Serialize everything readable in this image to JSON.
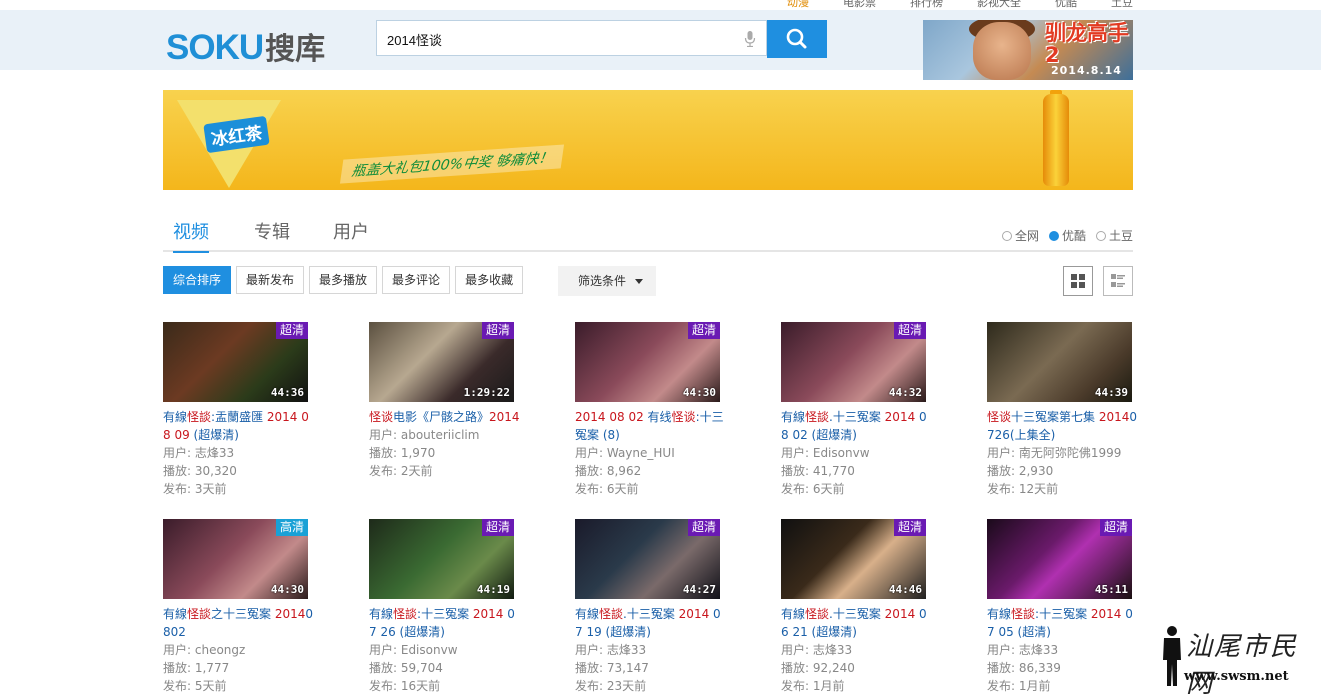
{
  "topnav": {
    "items": [
      "动漫",
      "电影票",
      "排行榜",
      "影视大全",
      "优酷",
      "土豆"
    ]
  },
  "logo": {
    "latin": "SOKU",
    "cn": "搜库"
  },
  "search": {
    "query": "2014怪谈"
  },
  "promo": {
    "title": "驯龙高手2",
    "date": "2014.8.14"
  },
  "ad": {
    "brand": "冰红茶",
    "slogan": "瓶盖大礼包100%中奖 够痛快！"
  },
  "tabs": [
    "视频",
    "专辑",
    "用户"
  ],
  "source_filter": [
    {
      "label": "全网",
      "selected": false
    },
    {
      "label": "优酷",
      "selected": true
    },
    {
      "label": "土豆",
      "selected": false
    }
  ],
  "sort": [
    "综合排序",
    "最新发布",
    "最多播放",
    "最多评论",
    "最多收藏"
  ],
  "filter_label": "筛选条件",
  "labels": {
    "user": "用户: ",
    "plays": "播放: ",
    "published": "发布: "
  },
  "colors": {
    "accent": "#1f8fe0",
    "highlight": "#c8161d",
    "badge_super": "#6a1ab3",
    "badge_hd": "#19a1d6"
  },
  "videos": [
    {
      "title": [
        [
          "有線",
          ""
        ],
        [
          "怪談",
          "hl"
        ],
        [
          ":盂蘭盛匯 ",
          ""
        ],
        [
          "2014 08 09",
          "hl"
        ],
        [
          " (超爆清)",
          ""
        ]
      ],
      "badge": "超清",
      "duration": "44:36",
      "user": "志烽33",
      "plays": "30,320",
      "published": "3天前"
    },
    {
      "title": [
        [
          "怪谈",
          "hl"
        ],
        [
          "电影《尸骸之路》",
          ""
        ],
        [
          "2014",
          "hl"
        ]
      ],
      "badge": "超清",
      "duration": "1:29:22",
      "user": "abouteriiclim",
      "plays": "1,970",
      "published": "2天前"
    },
    {
      "title": [
        [
          "2014 08 02",
          "hl"
        ],
        [
          " 有线",
          ""
        ],
        [
          "怪谈",
          "hl"
        ],
        [
          ":十三冤案 (8)",
          ""
        ]
      ],
      "badge": "超清",
      "duration": "44:30",
      "user": "Wayne_HUI",
      "plays": "8,962",
      "published": "6天前"
    },
    {
      "title": [
        [
          "有線",
          ""
        ],
        [
          "怪談",
          "hl"
        ],
        [
          ".十三冤案 ",
          ""
        ],
        [
          "2014",
          "hl"
        ],
        [
          " 08 02 (超爆清)",
          ""
        ]
      ],
      "badge": "超清",
      "duration": "44:32",
      "user": "Edisonvw",
      "plays": "41,770",
      "published": "6天前"
    },
    {
      "title": [
        [
          "怪谈",
          "hl"
        ],
        [
          "十三冤案第七集 ",
          ""
        ],
        [
          "2014",
          "hl"
        ],
        [
          "0726(上集全)",
          ""
        ]
      ],
      "badge": "",
      "duration": "44:39",
      "user": "南无阿弥陀佛1999",
      "plays": "2,930",
      "published": "12天前"
    },
    {
      "title": [
        [
          "有線",
          ""
        ],
        [
          "怪談",
          "hl"
        ],
        [
          "之十三冤案 ",
          ""
        ],
        [
          "2014",
          "hl"
        ],
        [
          "0802",
          ""
        ]
      ],
      "badge": "高清",
      "duration": "44:30",
      "user": "cheongz",
      "plays": "1,777",
      "published": "5天前"
    },
    {
      "title": [
        [
          "有線",
          ""
        ],
        [
          "怪談",
          "hl"
        ],
        [
          ":十三冤案 ",
          ""
        ],
        [
          "2014",
          "hl"
        ],
        [
          " 07 26 (超爆清)",
          ""
        ]
      ],
      "badge": "超清",
      "duration": "44:19",
      "user": "Edisonvw",
      "plays": "59,704",
      "published": "16天前"
    },
    {
      "title": [
        [
          "有線",
          ""
        ],
        [
          "怪談",
          "hl"
        ],
        [
          ".十三冤案 ",
          ""
        ],
        [
          "2014",
          "hl"
        ],
        [
          " 07 19 (超爆清)",
          ""
        ]
      ],
      "badge": "超清",
      "duration": "44:27",
      "user": "志烽33",
      "plays": "73,147",
      "published": "23天前"
    },
    {
      "title": [
        [
          "有線",
          ""
        ],
        [
          "怪談",
          "hl"
        ],
        [
          ".十三冤案 ",
          ""
        ],
        [
          "2014",
          "hl"
        ],
        [
          " 06 21 (超爆清)",
          ""
        ]
      ],
      "badge": "超清",
      "duration": "44:46",
      "user": "志烽33",
      "plays": "92,240",
      "published": "1月前"
    },
    {
      "title": [
        [
          "有線",
          ""
        ],
        [
          "怪談",
          "hl"
        ],
        [
          ":十三冤案 ",
          ""
        ],
        [
          "2014",
          "hl"
        ],
        [
          " 07 05 (超清)",
          ""
        ]
      ],
      "badge": "超清",
      "duration": "45:11",
      "user": "志烽33",
      "plays": "86,339",
      "published": "1月前"
    }
  ],
  "watermark": {
    "cn": "汕尾市民网",
    "url": "www.swsm.net"
  }
}
